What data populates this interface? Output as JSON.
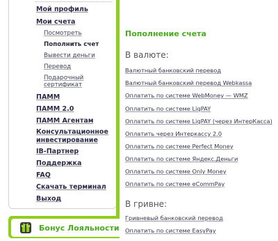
{
  "sidebar": {
    "menu": [
      {
        "label": "Мой профиль"
      },
      {
        "label": "Мои счета"
      }
    ],
    "submenu": [
      {
        "label": "Посмотреть"
      },
      {
        "label": "Пополнить счет"
      },
      {
        "label": "Вывести деньги"
      },
      {
        "label": "Перевод"
      },
      {
        "label": "Подарочный сертификат"
      }
    ],
    "menu2": [
      {
        "label": "ПАММ"
      },
      {
        "label": "ПАММ 2.0"
      },
      {
        "label": "ПАММ Агентам"
      },
      {
        "label": "Консультационное инвестирование"
      },
      {
        "label": "IB-Партнер"
      },
      {
        "label": "Поддержка"
      },
      {
        "label": "FAQ"
      },
      {
        "label": "Скачать терминал"
      },
      {
        "label": "Выход"
      }
    ]
  },
  "loyalty": {
    "label": "Бонус Лояльности"
  },
  "main": {
    "title": "Пополнение счета",
    "currency_heading": "В валюте:",
    "currency_links": [
      "Валютный банковский перевод",
      "Валютный банковский перевод Webkassa",
      "Оплатить по системе WebMoney — WMZ",
      "Оплатить по системе LiqPAY",
      "Оплатить по системе LiqPAY (через ИнтерКасса)",
      "Оплатить через Интеркассу 2.0",
      "Оплатить по системе Perfect Money",
      "Оплатить по системе Яндекс.Деньги",
      "Оплатить по системе Only Money",
      "Оплатить по системе eCommPay"
    ],
    "hryvnia_heading": "В гривне:",
    "hryvnia_links": [
      "Гривневый банковский перевод",
      "Оплатить по системе EasyPay"
    ]
  },
  "colors": {
    "accent_green": "#8fcf1c",
    "title_green": "#4aa91e"
  }
}
